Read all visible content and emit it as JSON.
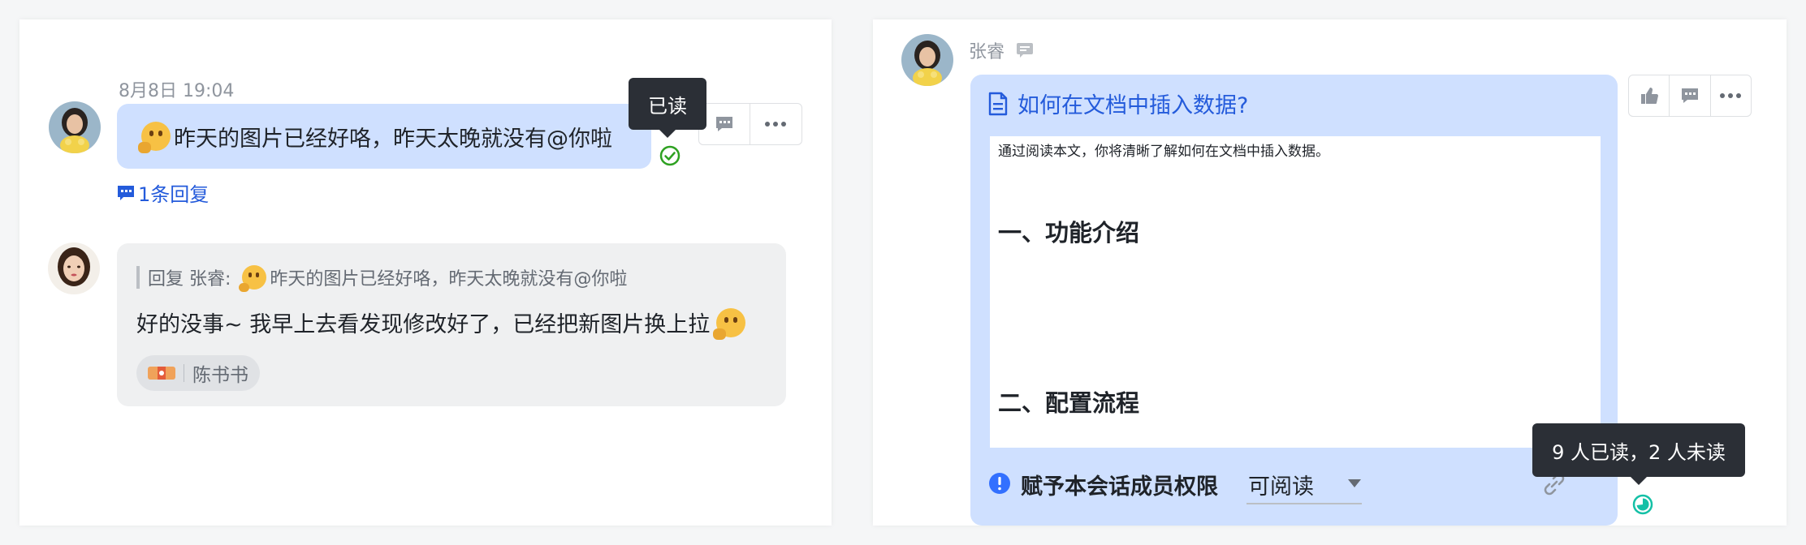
{
  "left": {
    "msg1": {
      "timestamp": "8月8日 19:04",
      "text": "昨天的图片已经好咯，昨天太晚就没有@你啦",
      "tooltip": "已读",
      "reply_count": "1条回复"
    },
    "msg2": {
      "quote_prefix": "回复 张睿:",
      "quote_text": "昨天的图片已经好咯，昨天太晚就没有@你啦",
      "text": "好的没事~ 我早上去看发现修改好了，已经把新图片换上拉",
      "reaction_user": "陈书书"
    }
  },
  "right": {
    "sender": "张睿",
    "doc": {
      "title": "如何在文档中插入数据?",
      "intro": "通过阅读本文，你将清晰了解如何在文档中插入数据。",
      "heading1": "一、功能介绍",
      "heading2": "二、配置流程"
    },
    "permission": {
      "label": "赋予本会话成员权限",
      "value": "可阅读"
    },
    "tooltip": "9 人已读，2 人未读"
  },
  "colors": {
    "accent": "#245bdb",
    "bubble_blue": "#cfe0ff",
    "bubble_gray": "#eff0f1",
    "read_green": "#2ea121",
    "read_teal": "#14c0a6",
    "tooltip_bg": "#2b2f36"
  },
  "icons": [
    "check-circle-icon",
    "comment-icon",
    "more-icon",
    "reply-icon",
    "thumbs-up-icon",
    "doc-icon",
    "info-icon",
    "link-icon",
    "dropdown-arrow-icon",
    "read-progress-icon"
  ]
}
